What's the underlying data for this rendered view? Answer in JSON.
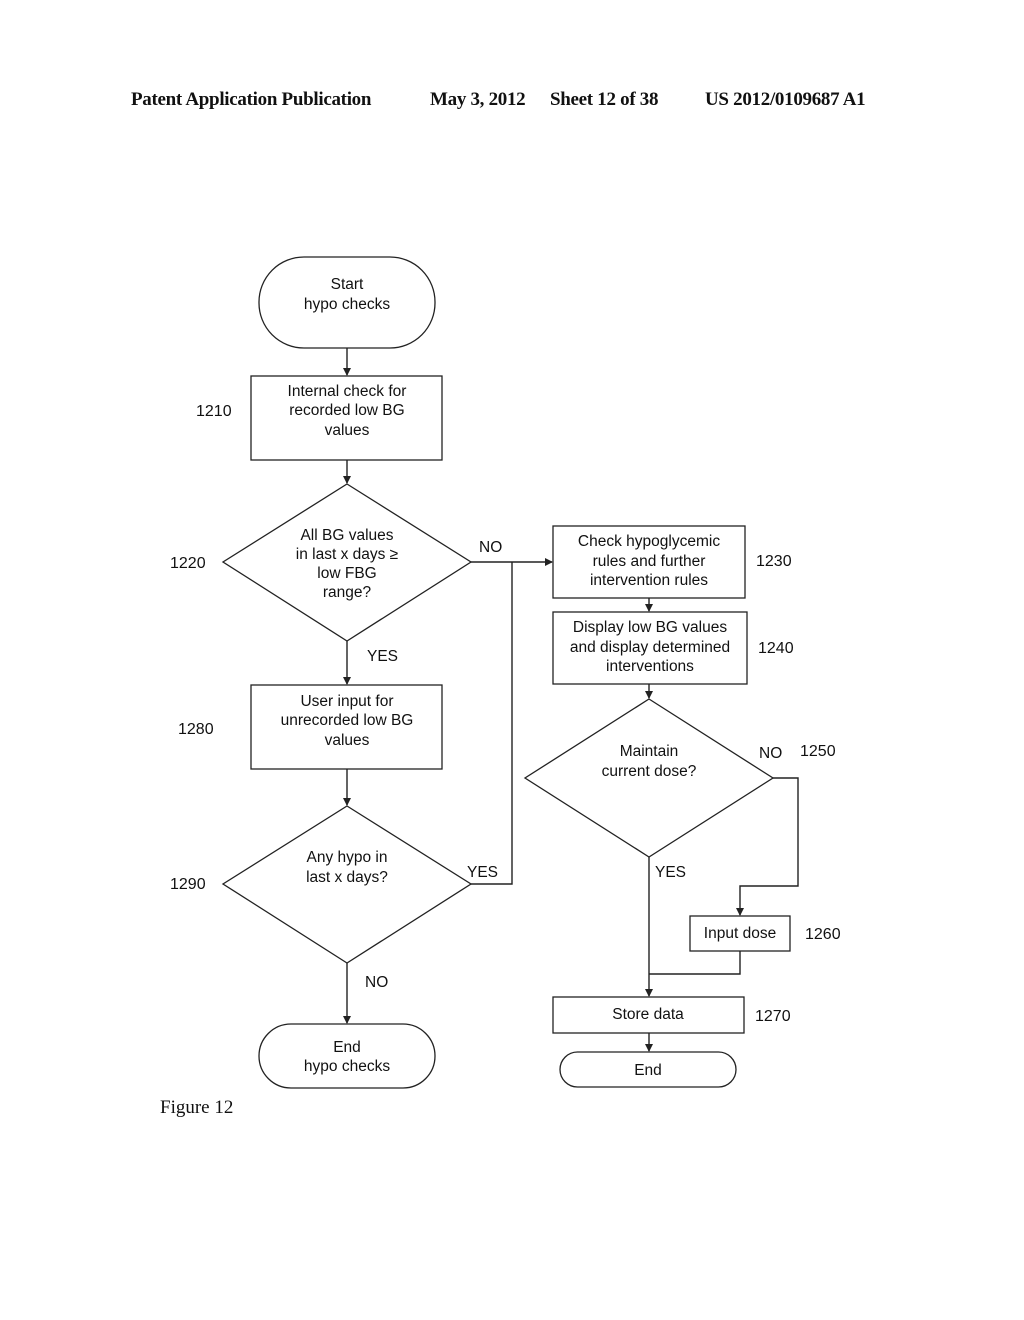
{
  "header": {
    "publication": "Patent Application Publication",
    "date": "May 3, 2012",
    "sheet": "Sheet 12 of 38",
    "number": "US 2012/0109687 A1"
  },
  "figure_label": "Figure 12",
  "nodes": {
    "start": {
      "lines": [
        "Start",
        "hypo checks"
      ]
    },
    "n1210": {
      "ref": "1210",
      "lines": [
        "Internal check for",
        "recorded low BG",
        "values"
      ]
    },
    "n1220": {
      "ref": "1220",
      "lines": [
        "All BG values",
        "in last x days ≥",
        "low FBG",
        "range?"
      ]
    },
    "n1230": {
      "ref": "1230",
      "lines": [
        "Check hypoglycemic",
        "rules and further",
        "intervention rules"
      ]
    },
    "n1240": {
      "ref": "1240",
      "lines": [
        "Display low BG values",
        "and display determined",
        "interventions"
      ]
    },
    "n1250": {
      "ref": "1250",
      "lines": [
        "Maintain",
        "current dose?"
      ]
    },
    "n1260": {
      "ref": "1260",
      "lines": [
        "Input dose"
      ]
    },
    "n1270": {
      "ref": "1270",
      "lines": [
        "Store data"
      ]
    },
    "n1280": {
      "ref": "1280",
      "lines": [
        "User input for",
        "unrecorded low BG",
        "values"
      ]
    },
    "n1290": {
      "ref": "1290",
      "lines": [
        "Any hypo in",
        "last x days?"
      ]
    },
    "end_hypo": {
      "lines": [
        "End",
        "hypo checks"
      ]
    },
    "end": {
      "lines": [
        "End"
      ]
    }
  },
  "edge_labels": {
    "e1220_no": "NO",
    "e1220_yes": "YES",
    "e1290_yes": "YES",
    "e1290_no": "NO",
    "e1250_no": "NO",
    "e1250_yes": "YES"
  }
}
